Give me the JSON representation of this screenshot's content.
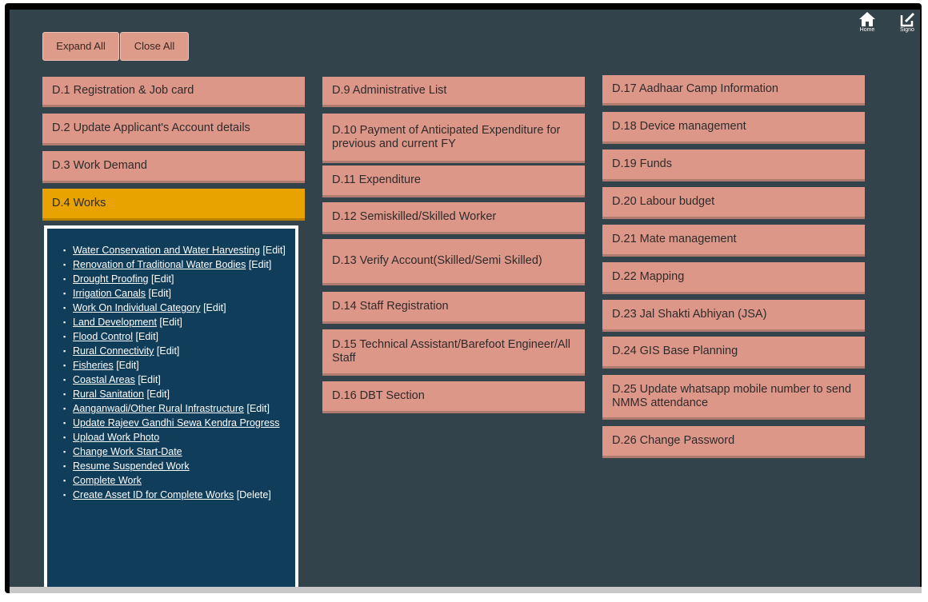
{
  "toolbar": {
    "expand_all": "Expand All",
    "close_all": "Close All"
  },
  "nav": {
    "home": "Home",
    "signout": "Signo"
  },
  "col1": [
    "D.1 Registration & Job card",
    "D.2 Update Applicant's Account details",
    "D.3 Work Demand",
    "D.4 Works"
  ],
  "col2": [
    "D.9 Administrative List",
    "D.10 Payment of Anticipated Expenditure for previous and current FY",
    "D.11 Expenditure",
    "D.12 Semiskilled/Skilled Worker",
    "D.13 Verify Account(Skilled/Semi Skilled)",
    "D.14 Staff Registration",
    "D.15 Technical Assistant/Barefoot Engineer/All Staff",
    "D.16 DBT Section"
  ],
  "col3": [
    "D.17 Aadhaar Camp Information",
    "D.18 Device management",
    "D.19 Funds",
    "D.20 Labour budget",
    "D.21 Mate management",
    "D.22 Mapping",
    "D.23 Jal Shakti Abhiyan (JSA)",
    "D.24 GIS Base Planning",
    "D.25 Update whatsapp mobile number to send NMMS attendance",
    "D.26 Change Password"
  ],
  "works": [
    {
      "label": "Water Conservation and Water Harvesting",
      "action": "[Edit]"
    },
    {
      "label": "Renovation of Traditional Water Bodies",
      "action": "[Edit]"
    },
    {
      "label": "Drought Proofing",
      "action": "[Edit]"
    },
    {
      "label": "Irrigation Canals",
      "action": "[Edit]"
    },
    {
      "label": "Work On Individual Category",
      "action": "[Edit]"
    },
    {
      "label": "Land Development",
      "action": "[Edit]"
    },
    {
      "label": "Flood Control",
      "action": "[Edit]"
    },
    {
      "label": "Rural Connectivity",
      "action": "[Edit]"
    },
    {
      "label": "Fisheries",
      "action": "[Edit]"
    },
    {
      "label": "Coastal Areas",
      "action": "[Edit]"
    },
    {
      "label": "Rural Sanitation",
      "action": "[Edit]"
    },
    {
      "label": "Aanganwadi/Other Rural Infrastructure",
      "action": "[Edit]"
    },
    {
      "label": "Update Rajeev Gandhi Sewa Kendra Progress",
      "action": ""
    },
    {
      "label": "Upload Work Photo",
      "action": ""
    },
    {
      "label": "Change Work Start-Date",
      "action": ""
    },
    {
      "label": "Resume Suspended Work",
      "action": ""
    },
    {
      "label": "Complete Work",
      "action": ""
    },
    {
      "label": "Create Asset ID for Complete Works",
      "action": "[Delete]"
    }
  ],
  "colors": {
    "tile": "#dd9789",
    "active": "#e8a300",
    "panel": "#0f3d5a",
    "background": "#33434c"
  },
  "icons": {
    "home": "home-icon",
    "signout": "sign-out-icon",
    "bullet": "square-bullet"
  }
}
